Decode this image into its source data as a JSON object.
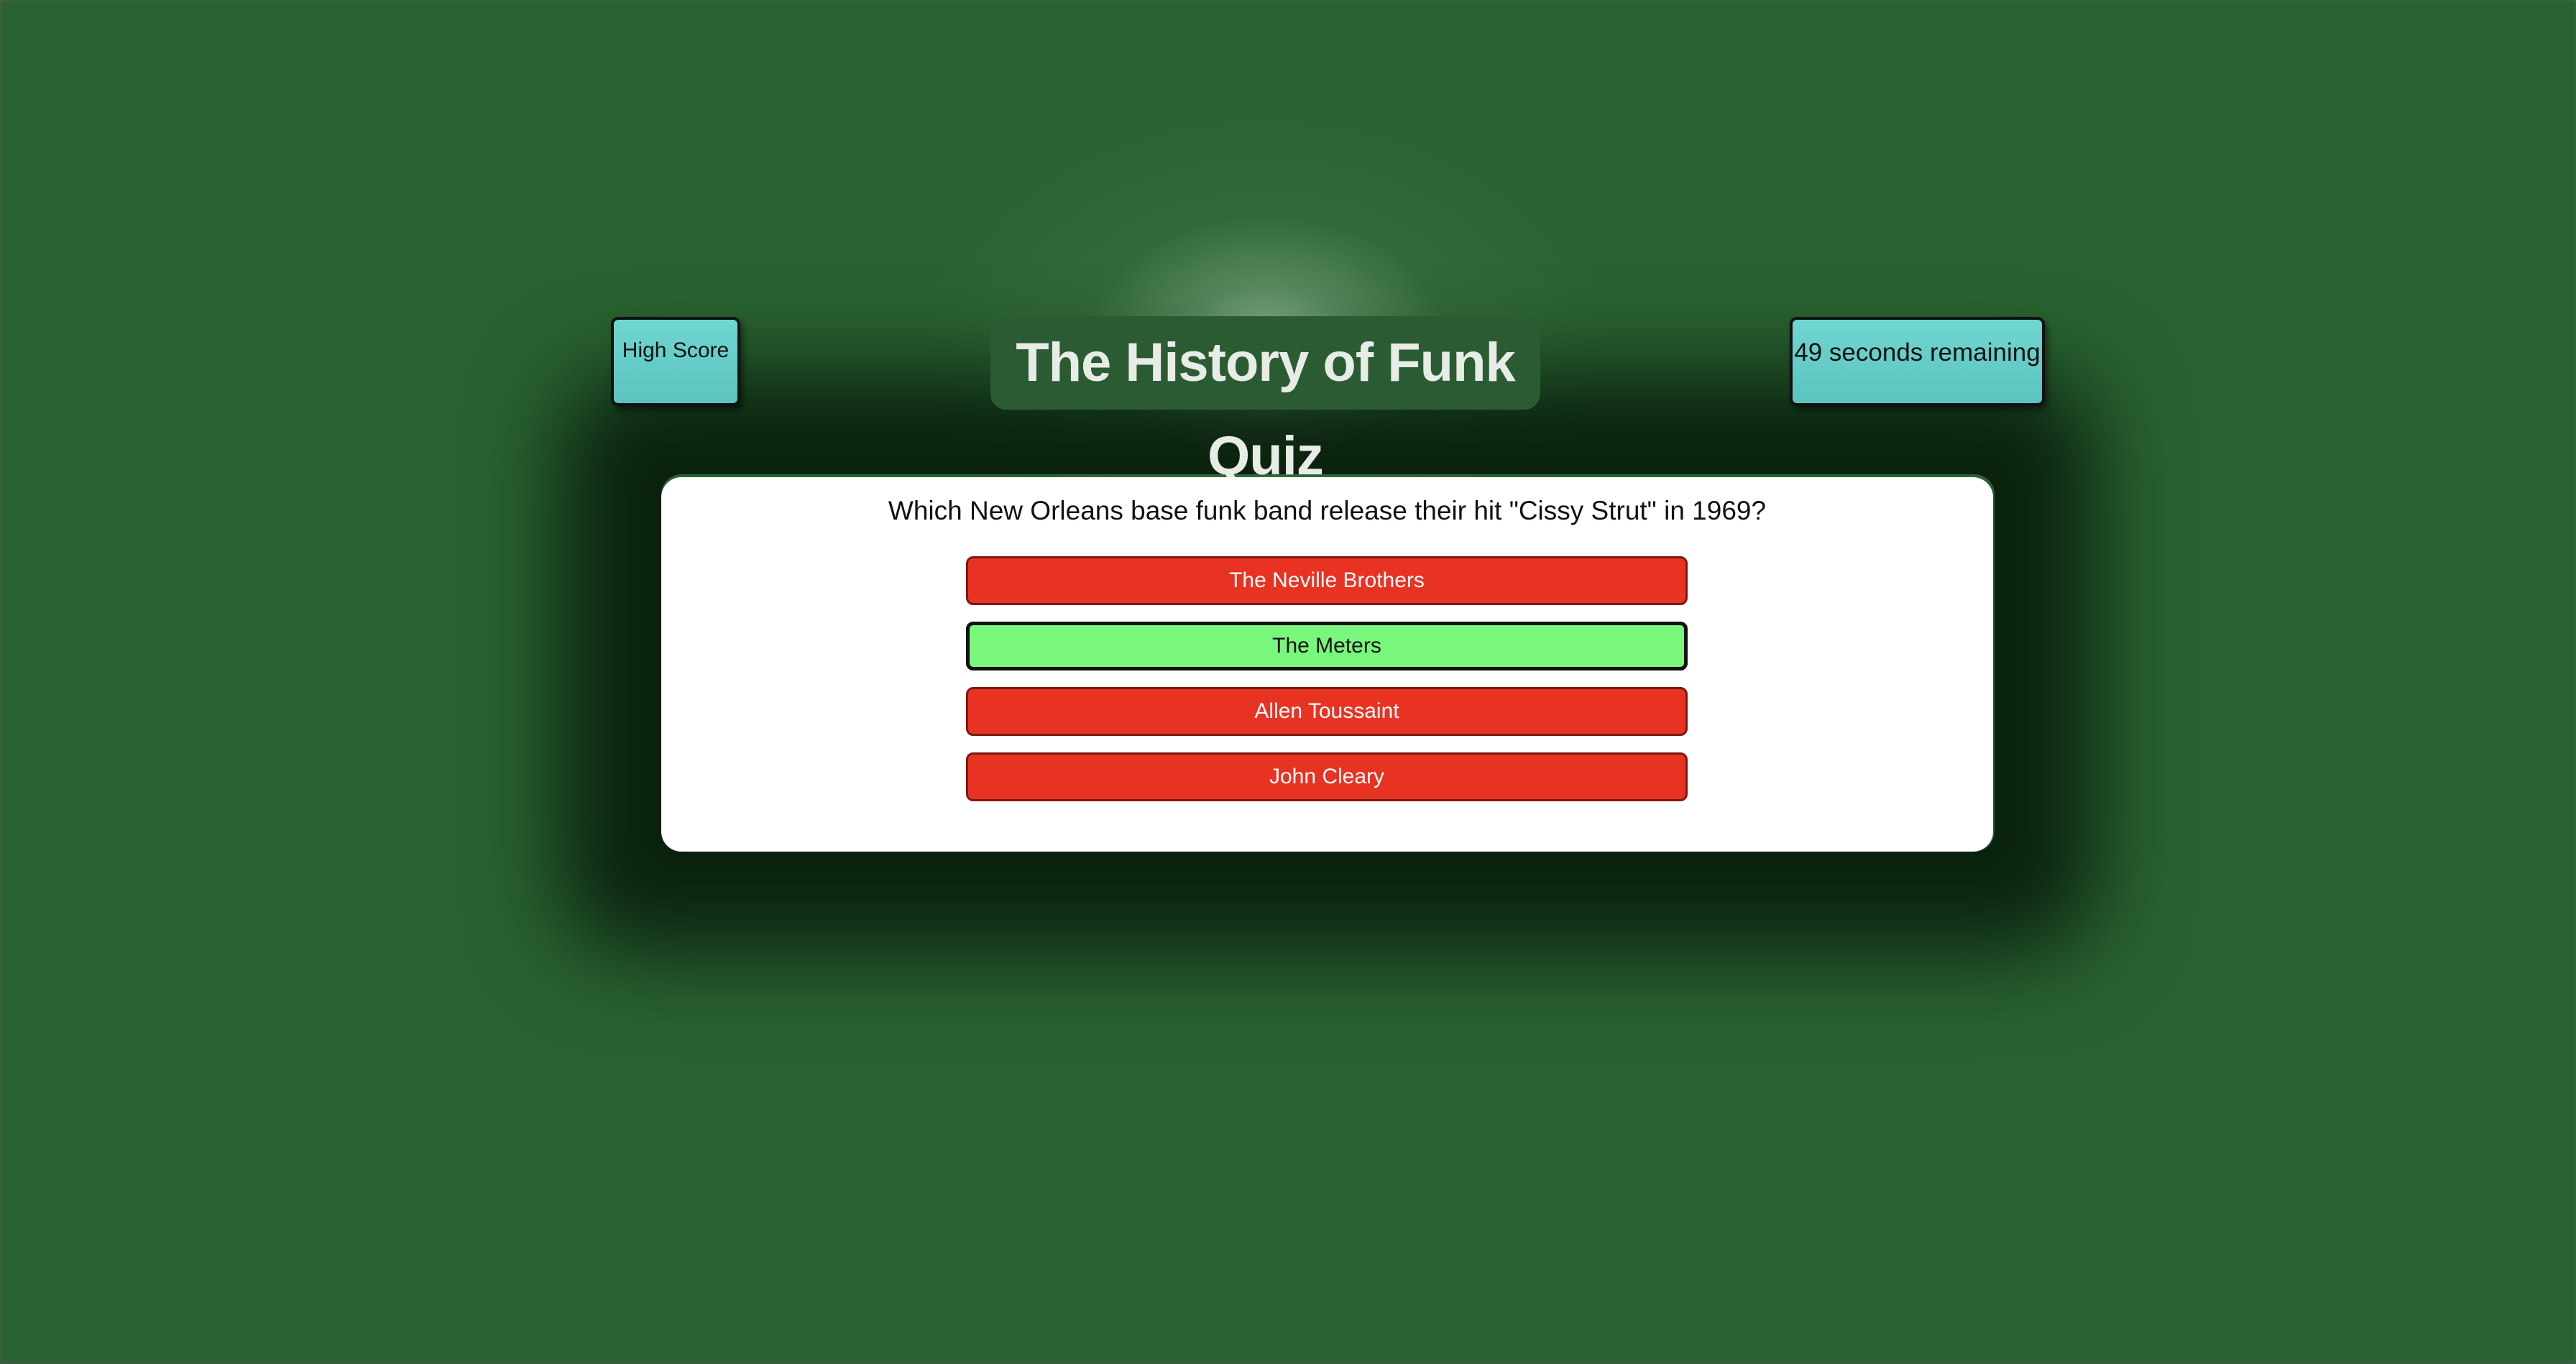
{
  "header": {
    "high_score_label": "High Score",
    "title": "The History of Funk Quiz",
    "timer_text": "49 seconds remaining"
  },
  "quiz": {
    "question": "Which New Orleans base funk band release their hit \"Cissy Strut\" in 1969?",
    "answers": [
      {
        "label": "The Neville Brothers",
        "state": "wrong"
      },
      {
        "label": "The Meters",
        "state": "correct"
      },
      {
        "label": "Allen Toussaint",
        "state": "wrong"
      },
      {
        "label": "John Cleary",
        "state": "wrong"
      }
    ]
  },
  "colors": {
    "background": "#2a6331",
    "title_box": "#2b5b32",
    "side_box": "#5cc3bf",
    "wrong_answer": "#e83323",
    "correct_answer": "#78f77c",
    "card": "#ffffff"
  }
}
